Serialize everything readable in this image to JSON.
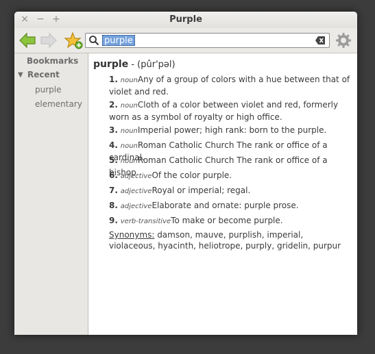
{
  "window": {
    "title": "Purple"
  },
  "titlebar": {
    "close": "×",
    "minimize": "−",
    "maximize": "+"
  },
  "search": {
    "value": "purple"
  },
  "sidebar": {
    "bookmarks": "Bookmarks",
    "recent": "Recent",
    "items": [
      "purple",
      "elementary"
    ]
  },
  "entry": {
    "word": "purple",
    "pron": "- (pûr'pəl)",
    "definitions": [
      {
        "n": "1.",
        "pos": "noun",
        "text": "Any of a group of colors with a hue between that of violet and red."
      },
      {
        "n": "2.",
        "pos": "noun",
        "text": "Cloth of a color between violet and red, formerly worn as a symbol of royalty or high office."
      },
      {
        "n": "3.",
        "pos": "noun",
        "text": "Imperial power; high rank:  born to the purple."
      },
      {
        "n": "4.",
        "pos": "noun",
        "text": "Roman Catholic Church   The rank or office of a cardinal."
      },
      {
        "n": "5.",
        "pos": "noun",
        "text": "Roman Catholic Church   The rank or office of a bishop."
      },
      {
        "n": "6.",
        "pos": "adjective",
        "text": "Of the color purple."
      },
      {
        "n": "7.",
        "pos": "adjective",
        "text": "Royal or imperial; regal."
      },
      {
        "n": "8.",
        "pos": "adjective",
        "text": "Elaborate and ornate:  purple prose."
      },
      {
        "n": "9.",
        "pos": "verb-transitive",
        "text": "To make or become purple."
      }
    ],
    "synonyms_label": "Synonyms:",
    "synonyms": "damson, mauve, purplish, imperial, violaceous, hyacinth, heliotrope, purply, gridelin, purpur"
  }
}
